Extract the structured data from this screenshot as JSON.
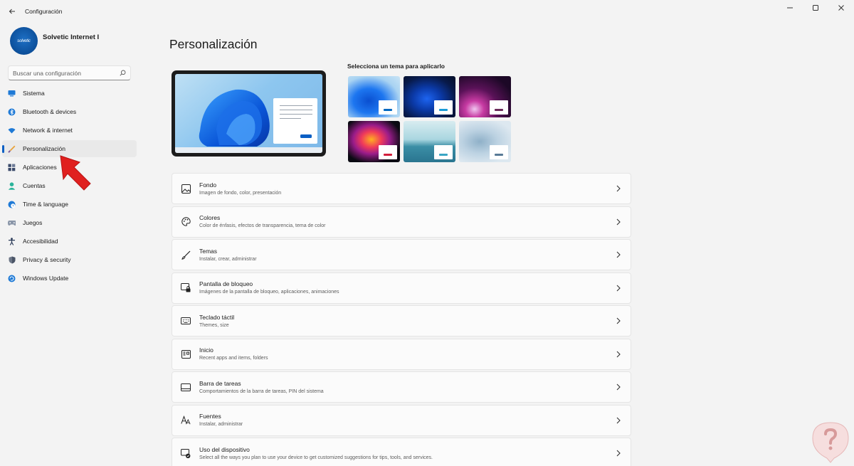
{
  "window": {
    "title": "Configuración"
  },
  "profile": {
    "name": "Solvetic Internet I",
    "avatar_text": "solvetic"
  },
  "search": {
    "placeholder": "Buscar una configuración"
  },
  "sidebar": {
    "items": [
      {
        "label": "Sistema",
        "icon": "monitor-icon"
      },
      {
        "label": "Bluetooth & devices",
        "icon": "bluetooth-icon"
      },
      {
        "label": "Network & internet",
        "icon": "wifi-icon"
      },
      {
        "label": "Personalización",
        "icon": "brush-icon",
        "active": true
      },
      {
        "label": "Aplicaciones",
        "icon": "apps-icon"
      },
      {
        "label": "Cuentas",
        "icon": "person-icon"
      },
      {
        "label": "Time & language",
        "icon": "globe-clock-icon"
      },
      {
        "label": "Juegos",
        "icon": "gamepad-icon"
      },
      {
        "label": "Accesibilidad",
        "icon": "accessibility-icon"
      },
      {
        "label": "Privacy & security",
        "icon": "shield-icon"
      },
      {
        "label": "Windows Update",
        "icon": "update-icon"
      }
    ]
  },
  "main": {
    "title": "Personalización",
    "themes_label": "Selecciona un tema para aplicarlo",
    "themes": [
      {
        "name": "windows-light",
        "accent": "#0067c0"
      },
      {
        "name": "windows-dark",
        "accent": "#1a9bd7"
      },
      {
        "name": "glow",
        "accent": "#6b2a5a"
      },
      {
        "name": "captured-motion",
        "accent": "#d21f3c"
      },
      {
        "name": "sunrise",
        "accent": "#3aa6c4"
      },
      {
        "name": "flow",
        "accent": "#587a96"
      }
    ],
    "cards": [
      {
        "title": "Fondo",
        "subtitle": "Imagen de fondo, color, presentación",
        "icon": "image-icon"
      },
      {
        "title": "Colores",
        "subtitle": "Color de énfasis, efectos de transparencia, tema de color",
        "icon": "palette-icon"
      },
      {
        "title": "Temas",
        "subtitle": "Instalar, crear, administrar",
        "icon": "brush-icon"
      },
      {
        "title": "Pantalla de bloqueo",
        "subtitle": "Imágenes de la pantalla de bloqueo, aplicaciones, animaciones",
        "icon": "lock-screen-icon"
      },
      {
        "title": "Teclado táctil",
        "subtitle": "Themes, size",
        "icon": "keyboard-icon"
      },
      {
        "title": "Inicio",
        "subtitle": "Recent apps and items, folders",
        "icon": "start-icon"
      },
      {
        "title": "Barra de tareas",
        "subtitle": "Comportamientos de la barra de tareas, PIN del sistema",
        "icon": "taskbar-icon"
      },
      {
        "title": "Fuentes",
        "subtitle": "Instalar, administrar",
        "icon": "fonts-icon"
      },
      {
        "title": "Uso del dispositivo",
        "subtitle": "Select all the ways you plan to use your device to get customized suggestions for tips, tools, and services.",
        "icon": "device-usage-icon"
      }
    ]
  },
  "colors": {
    "accent": "#0a5fc4",
    "pointer": "#e0201f"
  }
}
